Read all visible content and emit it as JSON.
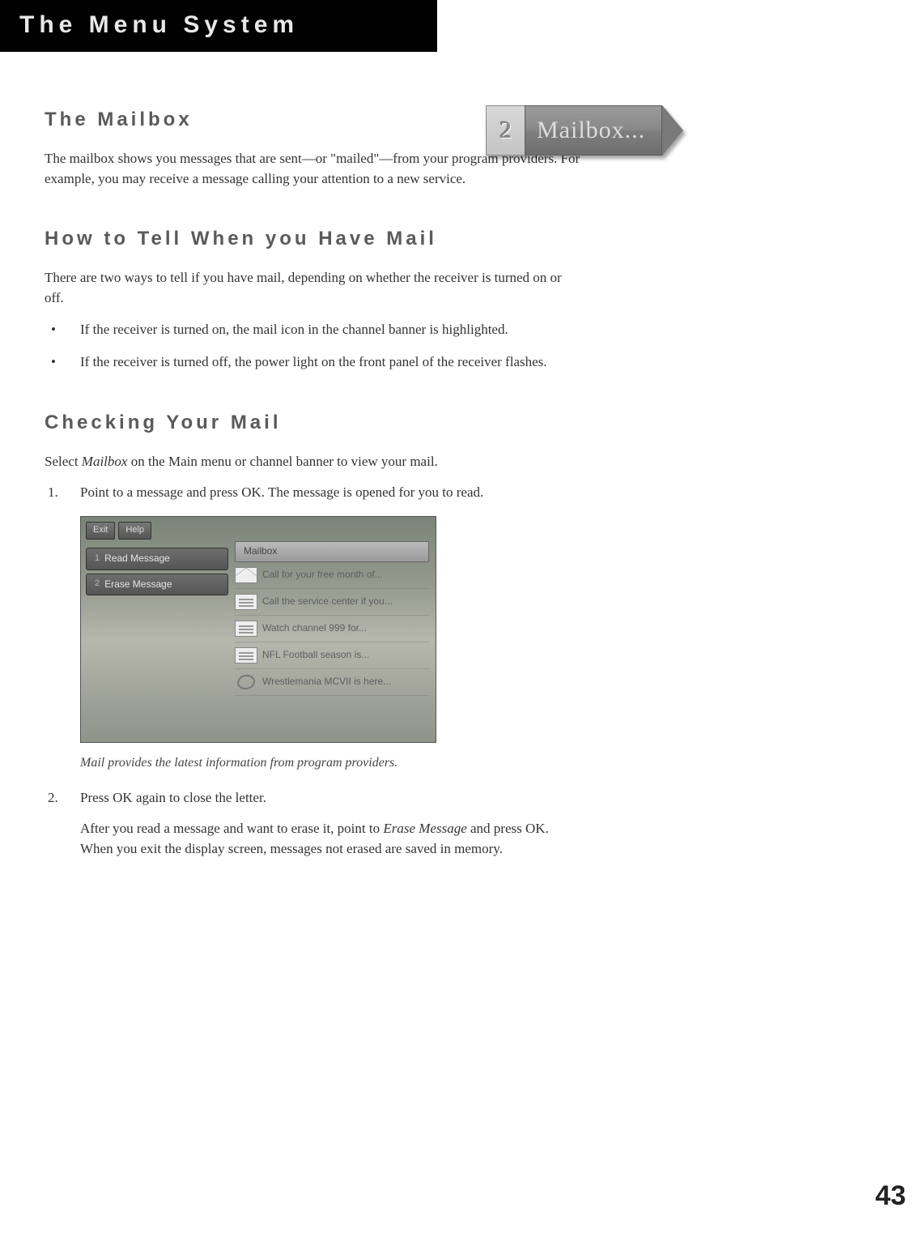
{
  "header": {
    "title": "The Menu System"
  },
  "badge": {
    "number": "2",
    "label": "Mailbox..."
  },
  "sections": {
    "mailbox": {
      "title": "The Mailbox",
      "body": "The mailbox shows you messages that are sent—or \"mailed\"—from your program providers. For example, you may receive a message calling your attention to a new service."
    },
    "howtell": {
      "title": "How to Tell When you Have Mail",
      "intro": "There are two ways to tell if you have mail, depending on whether the receiver is turned on or off.",
      "bullets": [
        "If the receiver is turned on, the mail icon in the channel banner is highlighted.",
        "If the receiver is turned off, the power light on the front panel of the receiver flashes."
      ]
    },
    "checking": {
      "title": "Checking Your Mail",
      "intro_a": "Select ",
      "intro_em": "Mailbox",
      "intro_b": " on the Main menu or channel banner to view your mail.",
      "step1": "Point to a message and press OK. The message is opened for you to read.",
      "step2": "Press OK again to close the letter.",
      "step2_sub_a": "After you read a message and want to erase it, point to ",
      "step2_sub_em": "Erase Message",
      "step2_sub_b": " and press OK. When you exit the display screen, messages not erased are saved in memory."
    }
  },
  "screenshot": {
    "topbar": {
      "exit": "Exit",
      "help": "Help"
    },
    "sidebar": [
      {
        "num": "1",
        "label": "Read Message"
      },
      {
        "num": "2",
        "label": "Erase Message"
      }
    ],
    "list_header": "Mailbox",
    "rows": [
      {
        "icon": "env",
        "text": "Call for your free month of..."
      },
      {
        "icon": "doc",
        "text": "Call the service center if you..."
      },
      {
        "icon": "doc",
        "text": "Watch channel 999 for..."
      },
      {
        "icon": "doc",
        "text": "NFL Football season is..."
      },
      {
        "icon": "ring",
        "text": "Wrestlemania MCVII is here..."
      }
    ],
    "caption": "Mail provides the latest information from program providers."
  },
  "page_number": "43"
}
